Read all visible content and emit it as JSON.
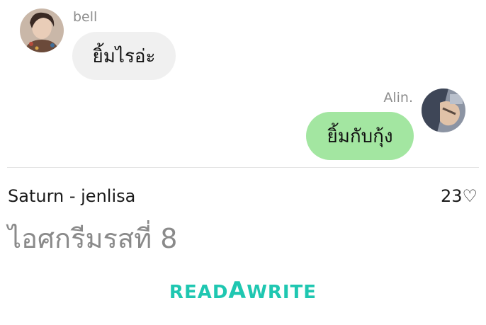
{
  "chat": {
    "messages": [
      {
        "sender": "bell",
        "text": "ยิ้มไรอ่ะ",
        "side": "left",
        "avatar": "avatar-bell"
      },
      {
        "sender": "Alin.",
        "text": "ยิ้มกับกุ้ง",
        "side": "right",
        "avatar": "avatar-alin"
      }
    ]
  },
  "story": {
    "title": "Saturn - jenlisa",
    "likes": "23♡",
    "chapter_title": "ไอศกรีมรสที่ 8"
  },
  "brand": {
    "part1": "READ",
    "part2": "A",
    "part3": "WRITE",
    "color": "#1fc7b1"
  },
  "colors": {
    "left_bubble": "#f0f0f0",
    "right_bubble": "#a3e6a1"
  }
}
